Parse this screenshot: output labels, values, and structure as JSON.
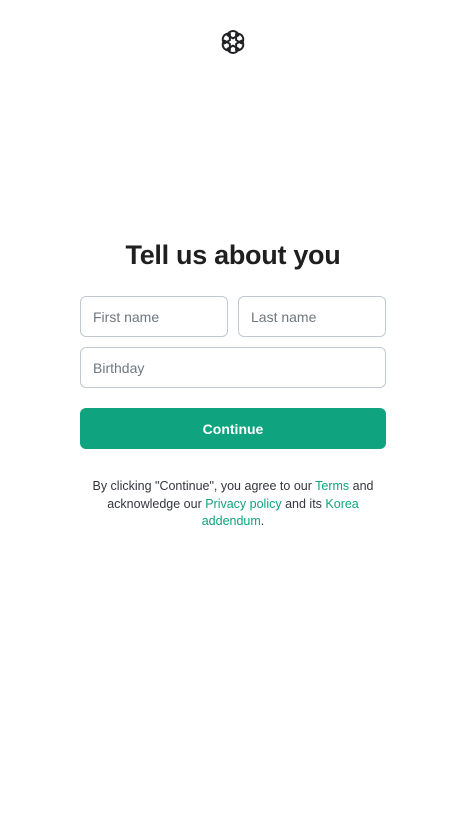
{
  "brand": {
    "logo_icon": "openai-logo-icon",
    "accent_color": "#10a37f"
  },
  "form": {
    "title": "Tell us about you",
    "first_name_placeholder": "First name",
    "last_name_placeholder": "Last name",
    "birthday_placeholder": "Birthday",
    "continue_label": "Continue"
  },
  "legal": {
    "text_before_terms": "By clicking \"Continue\", you agree to our ",
    "terms_link": "Terms",
    "text_between_1": " and acknowledge our ",
    "privacy_link": "Privacy policy",
    "text_between_2": " and its ",
    "korea_link": "Korea addendum",
    "text_after": "."
  }
}
